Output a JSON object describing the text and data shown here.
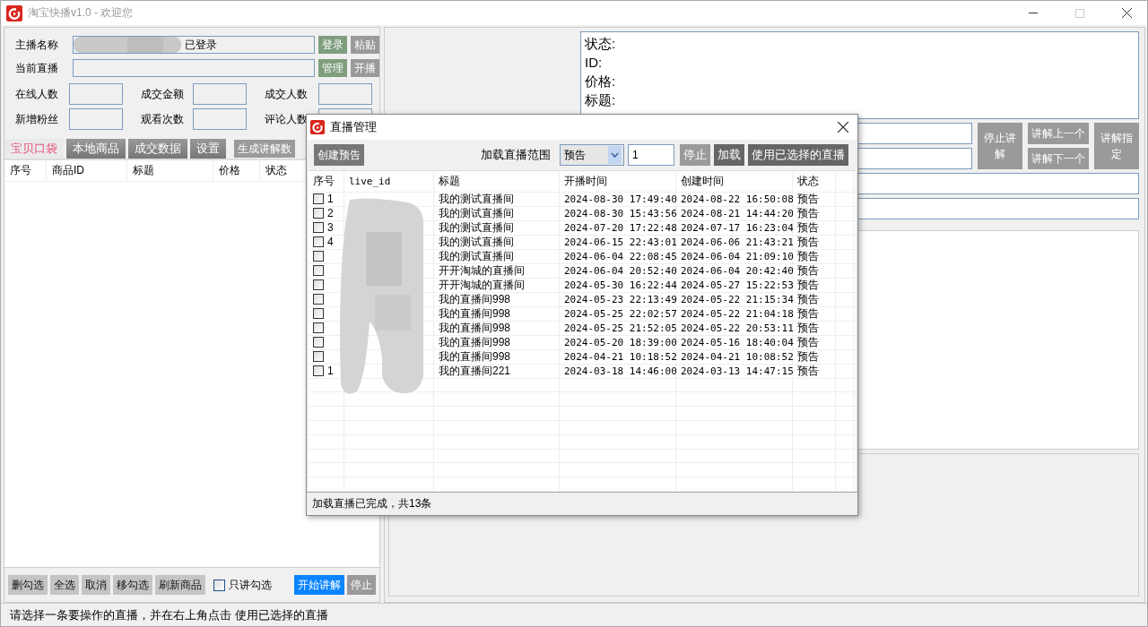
{
  "window": {
    "title": "淘宝快播v1.0 - 欢迎您"
  },
  "account": [
    {
      "label": "主播名称",
      "value": "已登录",
      "buttons": [
        {
          "label": "登录",
          "enabled": true
        },
        {
          "label": "粘贴",
          "enabled": false
        }
      ]
    },
    {
      "label": "当前直播",
      "buttons": [
        {
          "label": "管理",
          "enabled": true
        },
        {
          "label": "开播",
          "enabled": false
        }
      ]
    }
  ],
  "stats": [
    {
      "label": "在线人数"
    },
    {
      "label": "成交金额"
    },
    {
      "label": "成交人数"
    },
    {
      "label": "新增粉丝"
    },
    {
      "label": "观看次数"
    },
    {
      "label": "评论人数"
    }
  ],
  "tabs": [
    {
      "label": "宝贝口袋",
      "selected": true
    },
    {
      "label": "本地商品",
      "selected": false
    },
    {
      "label": "成交数据",
      "selected": false
    },
    {
      "label": "设置",
      "selected": false
    }
  ],
  "generate_button": {
    "label": "生成讲解数"
  },
  "product_table": {
    "columns": [
      "序号",
      "商品ID",
      "标题",
      "价格",
      "状态"
    ]
  },
  "bottom_buttons": [
    {
      "label": "删勾选"
    },
    {
      "label": "全选"
    },
    {
      "label": "取消"
    },
    {
      "label": "移勾选"
    },
    {
      "label": "刷新商品"
    }
  ],
  "only_checked": {
    "label": "只讲勾选",
    "checked": false
  },
  "start_button": {
    "label": "开始讲解",
    "enabled": true
  },
  "stop_button": {
    "label": "停止",
    "enabled": false
  },
  "info_lines": [
    "状态:",
    "ID:",
    "价格:",
    "标题:"
  ],
  "explain_buttons": [
    {
      "label": "停止讲解",
      "enabled": false
    },
    {
      "label": "讲解上一个",
      "enabled": false
    },
    {
      "label": "讲解下一个",
      "enabled": false
    },
    {
      "label": "讲解指定",
      "enabled": false
    }
  ],
  "status_bar": "请选择一条要操作的直播，并在右上角点击 使用已选择的直播",
  "dialog": {
    "title": "直播管理",
    "create_button": {
      "label": "创建预告",
      "enabled": true
    },
    "range_label": "加载直播范围",
    "range_select": "预告",
    "count_value": "1",
    "buttons": [
      {
        "label": "停止",
        "enabled": false
      },
      {
        "label": "加载",
        "enabled": true
      },
      {
        "label": "使用已选择的直播",
        "enabled": true
      }
    ],
    "columns": [
      "序号",
      "live_id",
      "标题",
      "开播时间",
      "创建时间",
      "状态"
    ],
    "rows": [
      {
        "seq": "1",
        "checked": false,
        "title": "我的测试直播间",
        "start": "2024-08-30 17:49:40",
        "created": "2024-08-22 16:50:08",
        "status": "预告"
      },
      {
        "seq": "2",
        "checked": false,
        "title": "我的测试直播间",
        "start": "2024-08-30 15:43:56",
        "created": "2024-08-21 14:44:20",
        "status": "预告"
      },
      {
        "seq": "3",
        "checked": false,
        "title": "我的测试直播间",
        "start": "2024-07-20 17:22:48",
        "created": "2024-07-17 16:23:04",
        "status": "预告"
      },
      {
        "seq": "4",
        "checked": false,
        "title": "我的测试直播间",
        "start": "2024-06-15 22:43:01",
        "created": "2024-06-06 21:43:21",
        "status": "预告"
      },
      {
        "checked": false,
        "title": "我的测试直播间",
        "start": "2024-06-04 22:08:45",
        "created": "2024-06-04 21:09:10",
        "status": "预告"
      },
      {
        "checked": false,
        "title": "开开淘城的直播间",
        "start": "2024-06-04 20:52:40",
        "created": "2024-06-04 20:42:40",
        "status": "预告"
      },
      {
        "checked": false,
        "title": "开开淘城的直播间",
        "start": "2024-05-30 16:22:44",
        "created": "2024-05-27 15:22:53",
        "status": "预告"
      },
      {
        "checked": false,
        "title": "我的直播间998",
        "start": "2024-05-23 22:13:49",
        "created": "2024-05-22 21:15:34",
        "status": "预告"
      },
      {
        "checked": false,
        "title": "我的直播间998",
        "start": "2024-05-25 22:02:57",
        "created": "2024-05-22 21:04:18",
        "status": "预告"
      },
      {
        "checked": false,
        "title": "我的直播间998",
        "start": "2024-05-25 21:52:05",
        "created": "2024-05-22 20:53:11",
        "status": "预告"
      },
      {
        "checked": false,
        "title": "我的直播间998",
        "start": "2024-05-20 18:39:00",
        "created": "2024-05-16 18:40:04",
        "status": "预告"
      },
      {
        "checked": false,
        "title": "我的直播间998",
        "start": "2024-04-21 10:18:52",
        "created": "2024-04-21 10:08:52",
        "status": "预告"
      },
      {
        "seq": "1",
        "checked": false,
        "title": "我的直播间221",
        "start": "2024-03-18 14:46:00",
        "created": "2024-03-13 14:47:15",
        "status": "预告"
      }
    ],
    "status": "加载直播已完成，共13条"
  }
}
